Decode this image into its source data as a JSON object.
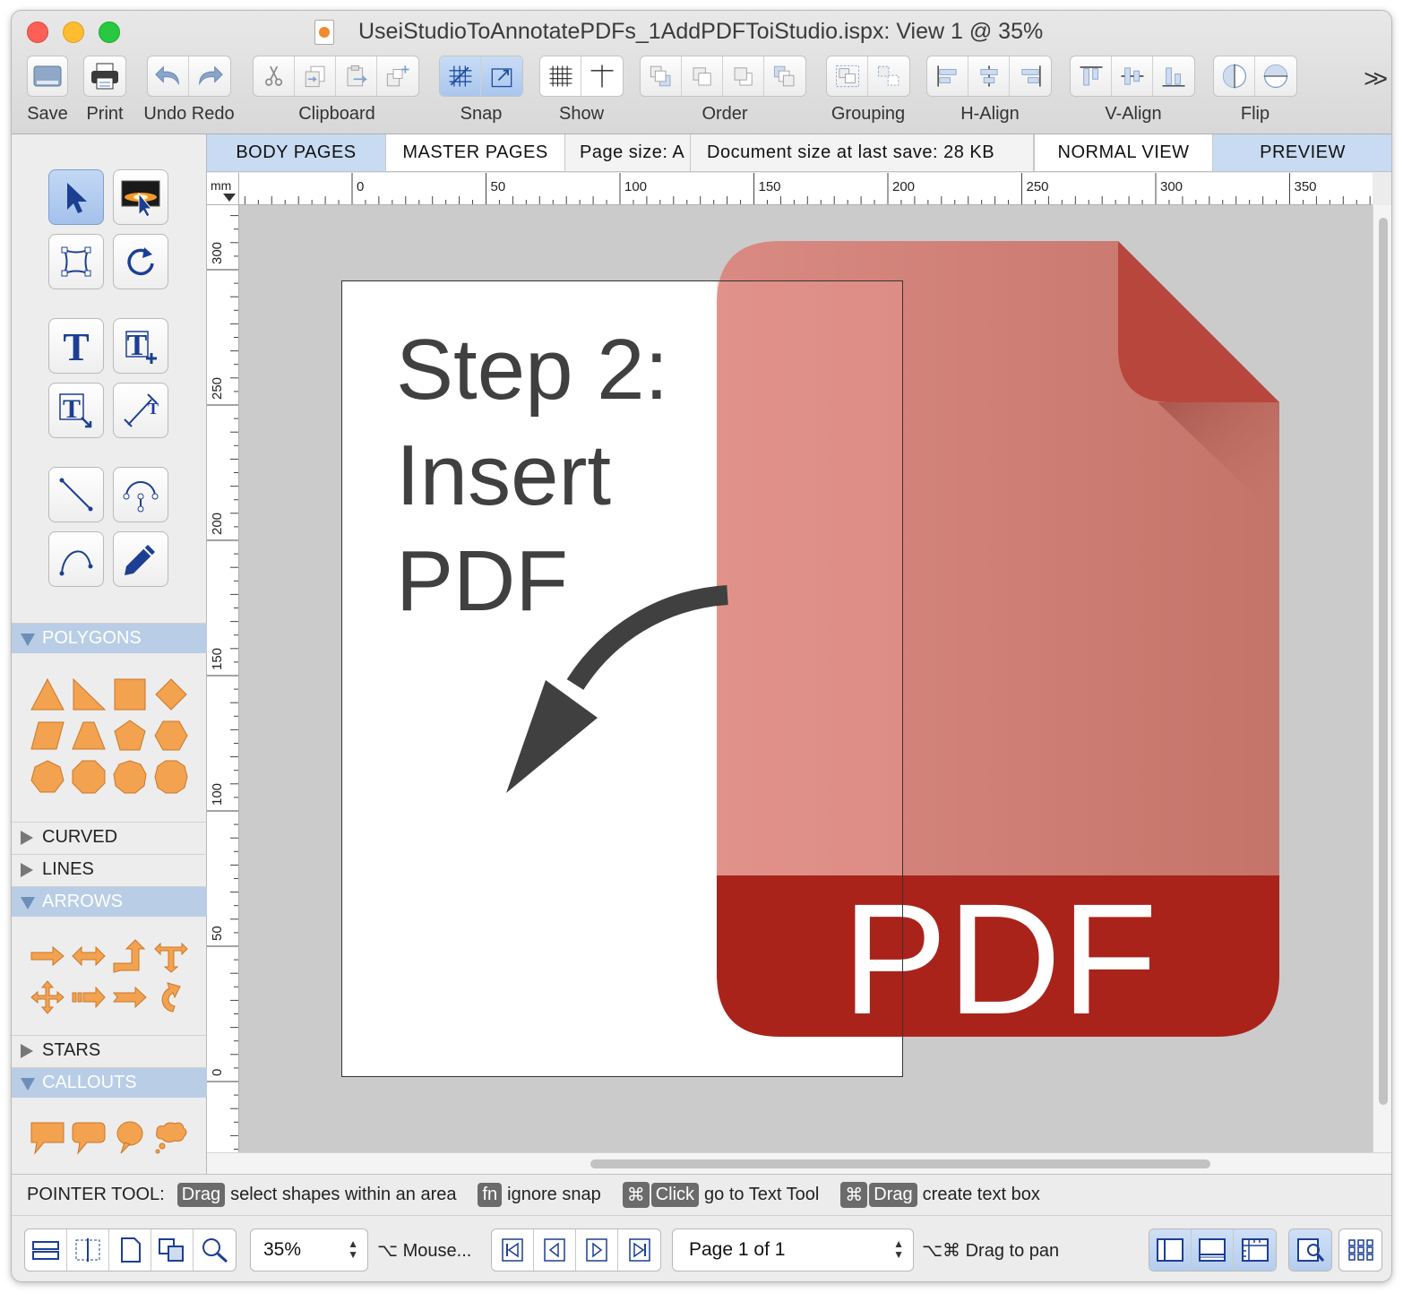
{
  "window": {
    "title": "UseiStudioToAnnotatePDFs_1AddPDFToiStudio.ispx: View 1 @ 35%"
  },
  "toolbar": {
    "save": "Save",
    "print": "Print",
    "undo_redo": "Undo Redo",
    "clipboard": "Clipboard",
    "snap": "Snap",
    "show": "Show",
    "order": "Order",
    "grouping": "Grouping",
    "h_align": "H-Align",
    "v_align": "V-Align",
    "flip": "Flip",
    "overflow": ">>"
  },
  "tabs": {
    "body_pages": "BODY PAGES",
    "master_pages": "MASTER PAGES",
    "page_size": "Page size:  A",
    "document_size": "Document size at last save:  28 KB",
    "normal_view": "NORMAL VIEW",
    "preview": "PREVIEW"
  },
  "ruler": {
    "unit": "mm",
    "h_labels": [
      "0",
      "50",
      "100",
      "150",
      "200",
      "250",
      "300",
      "350"
    ],
    "v_labels": [
      "300",
      "250",
      "200",
      "150",
      "100",
      "50",
      "0"
    ]
  },
  "sidebar": {
    "sections": {
      "polygons": "POLYGONS",
      "curved": "CURVED",
      "lines": "LINES",
      "arrows": "ARROWS",
      "stars": "STARS",
      "callouts": "CALLOUTS"
    }
  },
  "canvas": {
    "step_line1": "Step 2:",
    "step_line2": "Insert",
    "step_line3": "PDF",
    "pdf_label": "PDF"
  },
  "status": {
    "tool": "POINTER TOOL:",
    "hint1_key": "Drag",
    "hint1_text": "select shapes within an area",
    "hint2_key": "fn",
    "hint2_text": "ignore snap",
    "hint3_key1": "⌘",
    "hint3_key2": "Click",
    "hint3_text": "go to Text Tool",
    "hint4_key1": "⌘",
    "hint4_key2": "Drag",
    "hint4_text": "create text box"
  },
  "bottom": {
    "zoom": "35%",
    "mouse_hint": "⌥ Mouse...",
    "page": "Page 1 of 1",
    "pan_hint": "⌥⌘ Drag to pan"
  },
  "colors": {
    "pdf_red": "#a9231b",
    "pdf_body": "#cd7c73",
    "shape_orange": "#f3a24f",
    "accent_blue": "#b9cde6"
  }
}
